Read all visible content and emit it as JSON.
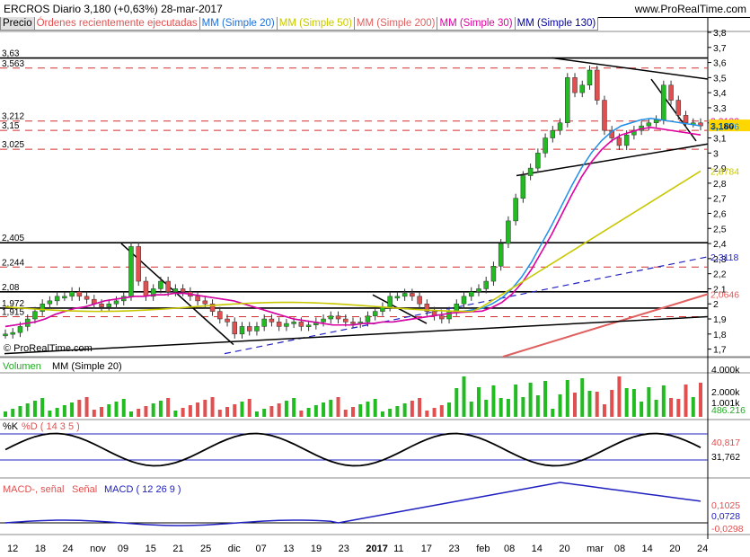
{
  "header": {
    "title": "ERCROS   Diario   3,180 (+0,63%)   28-mar-2017",
    "site": "www.ProRealTime.com"
  },
  "tabs": [
    {
      "label": "Precio",
      "color": "#000000"
    },
    {
      "label": "Órdenes recientemente ejecutadas",
      "color": "#e05050"
    },
    {
      "label": "MM (Simple 20)",
      "color": "#1f6fd8"
    },
    {
      "label": "MM (Simple 50)",
      "color": "#c8c800"
    },
    {
      "label": "MM (Simple 200)",
      "color": "#e06060"
    },
    {
      "label": "MM (Simple 30)",
      "color": "#e000a0"
    },
    {
      "label": "MM (Simple 130)",
      "color": "#0000a0"
    }
  ],
  "watermark": "© ProRealTime.com",
  "colors": {
    "up": "#22bb22",
    "down": "#e05050",
    "ma20": "#1f8fe8",
    "ma50": "#c8c800",
    "ma200": "#e06060",
    "ma30": "#e000a0",
    "ma130": "#2020c0"
  },
  "chart_data": [
    {
      "type": "candlestick",
      "title": "Precio",
      "ylim": [
        1.65,
        3.8
      ],
      "yticks": [
        "3,8",
        "3,7",
        "3,6",
        "3,5",
        "3,4",
        "3,3",
        "3,2",
        "3,1",
        "3",
        "2,9",
        "2,8",
        "2,7",
        "2,6",
        "2,5",
        "2,4",
        "2,3",
        "2,2",
        "2,1",
        "2",
        "1,9",
        "1,8",
        "1,7"
      ],
      "xticks": [
        "12",
        "18",
        "24",
        "nov",
        "09",
        "15",
        "21",
        "25",
        "dic",
        "07",
        "13",
        "19",
        "23",
        "2017",
        "11",
        "17",
        "23",
        "feb",
        "08",
        "14",
        "20",
        "mar",
        "08",
        "14",
        "20",
        "24"
      ],
      "levels": [
        {
          "label": "3,63",
          "value": 3.63,
          "style": "solid"
        },
        {
          "label": "3,563",
          "value": 3.563,
          "style": "dashed"
        },
        {
          "label": "3,212",
          "value": 3.212,
          "style": "dashed"
        },
        {
          "label": "3,15",
          "value": 3.15,
          "style": "dashed"
        },
        {
          "label": "3,025",
          "value": 3.025,
          "style": "dashed"
        },
        {
          "label": "2,405",
          "value": 2.405,
          "style": "solid"
        },
        {
          "label": "2,244",
          "value": 2.244,
          "style": "dashed"
        },
        {
          "label": "2,08",
          "value": 2.08,
          "style": "solid"
        },
        {
          "label": "1,972",
          "value": 1.972,
          "style": "solid"
        },
        {
          "label": "1,915",
          "value": 1.915,
          "style": "dashed"
        }
      ],
      "price_labels": [
        {
          "label": "3,2133",
          "value": 3.2133,
          "color": "#e000a0"
        },
        {
          "label": "3,180",
          "value": 3.18,
          "color": "#000000",
          "bg": "#ffd700"
        },
        {
          "label": "3,1776",
          "value": 3.1776,
          "color": "#1f8fe8"
        },
        {
          "label": "2,8784",
          "value": 2.8784,
          "color": "#c8c800"
        },
        {
          "label": "2,3118",
          "value": 2.3118,
          "color": "#2020c0"
        },
        {
          "label": "2,0646",
          "value": 2.0646,
          "color": "#e06060"
        }
      ],
      "close": [
        1.8,
        1.81,
        1.85,
        1.9,
        1.95,
        2.0,
        2.02,
        2.05,
        2.05,
        2.08,
        2.05,
        2.03,
        2.0,
        1.98,
        2.0,
        2.02,
        2.05,
        2.38,
        2.15,
        2.05,
        2.1,
        2.15,
        2.08,
        2.1,
        2.08,
        2.05,
        2.02,
        2.0,
        1.95,
        1.9,
        1.88,
        1.8,
        1.85,
        1.82,
        1.85,
        1.9,
        1.88,
        1.85,
        1.87,
        1.88,
        1.85,
        1.86,
        1.88,
        1.9,
        1.92,
        1.9,
        1.88,
        1.87,
        1.88,
        1.92,
        1.95,
        1.98,
        2.05,
        2.05,
        2.07,
        2.05,
        2.0,
        1.95,
        1.92,
        1.9,
        1.95,
        2.0,
        2.05,
        2.08,
        2.1,
        2.15,
        2.25,
        2.4,
        2.55,
        2.7,
        2.85,
        2.9,
        3.0,
        3.1,
        3.15,
        3.2,
        3.5,
        3.4,
        3.45,
        3.55,
        3.35,
        3.15,
        3.1,
        3.05,
        3.12,
        3.15,
        3.18,
        3.2,
        3.22,
        3.45,
        3.35,
        3.25,
        3.2,
        3.2,
        3.18
      ],
      "ma20": [
        1.85,
        1.86,
        1.87,
        1.88,
        1.9,
        1.93,
        1.95,
        1.97,
        1.98,
        2.0,
        2.02,
        2.03,
        2.04,
        2.05,
        2.05,
        2.06,
        2.06,
        2.07,
        2.07,
        2.06,
        2.05,
        2.04,
        2.03,
        2.02,
        2.0,
        1.98,
        1.96,
        1.94,
        1.92,
        1.9,
        1.89,
        1.88,
        1.87,
        1.86,
        1.86,
        1.86,
        1.87,
        1.87,
        1.88,
        1.88,
        1.89,
        1.9,
        1.91,
        1.92,
        1.93,
        1.94,
        1.95,
        1.96,
        1.97,
        2.0,
        2.04,
        2.1,
        2.18,
        2.28,
        2.4,
        2.52,
        2.65,
        2.78,
        2.9,
        3.0,
        3.08,
        3.14,
        3.18,
        3.2,
        3.22,
        3.23,
        3.22,
        3.21,
        3.2,
        3.19,
        3.18
      ],
      "volume_title": "Volumen",
      "volume_series": "MM (Simple 20)",
      "volume_ticks": [
        "4.000k",
        "2.000k",
        "1.001k"
      ],
      "volume_last": "486.216",
      "stoch_title": "%K",
      "stoch_series": "%D ( 14 3 5 )",
      "stoch_last": [
        "40,817",
        "31,762"
      ],
      "macd_series": [
        "MACD-, señal",
        "Señal",
        "MACD ( 12 26 9 )"
      ],
      "macd_last": [
        "0,1025",
        "0,0728",
        "-0,0298"
      ]
    }
  ]
}
